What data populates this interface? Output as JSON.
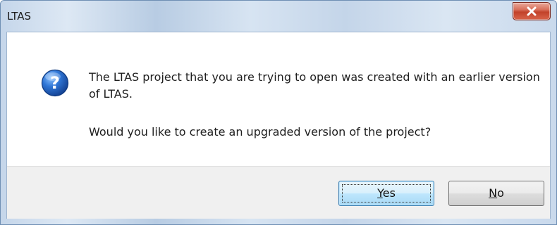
{
  "window": {
    "title": "LTAS",
    "close_icon": "close-icon"
  },
  "message": {
    "icon": "question-icon",
    "line1": "The LTAS project that you are trying to open was created with an earlier version of LTAS.",
    "line2": "Would you like to create an upgraded version of the project?"
  },
  "buttons": {
    "yes": {
      "mnemonic": "Y",
      "rest": "es"
    },
    "no": {
      "mnemonic": "N",
      "rest": "o"
    }
  },
  "colors": {
    "title_bar": "#c5d6ea",
    "close_button": "#c2422a",
    "default_button_border": "#3c7fb1",
    "icon_blue": "#1f5fbf"
  }
}
